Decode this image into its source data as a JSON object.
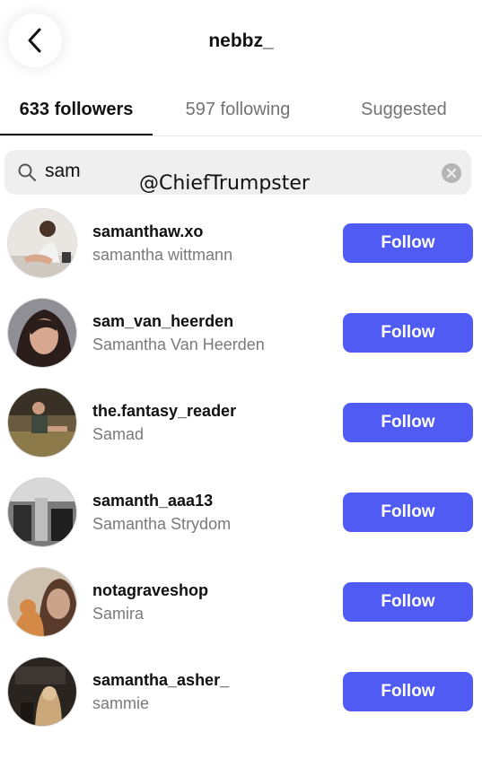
{
  "header": {
    "title": "nebbz_",
    "back_icon": "chevron-left-icon"
  },
  "tabs": [
    {
      "label": "633 followers",
      "active": true
    },
    {
      "label": "597 following",
      "active": false
    },
    {
      "label": "Suggested",
      "active": false
    }
  ],
  "search": {
    "value": "sam",
    "search_icon": "search-icon",
    "clear_icon": "clear-icon"
  },
  "watermark": "@ChiefTrumpster",
  "accent_color": "#4f5bf2",
  "follow_label": "Follow",
  "users": [
    {
      "username": "samanthaw.xo",
      "name": "samantha wittmann",
      "button": "Follow"
    },
    {
      "username": "sam_van_heerden",
      "name": "Samantha Van Heerden",
      "button": "Follow"
    },
    {
      "username": "the.fantasy_reader",
      "name": "Samad",
      "button": "Follow"
    },
    {
      "username": "samanth_aaa13",
      "name": "Samantha Strydom",
      "button": "Follow"
    },
    {
      "username": "notagraveshop",
      "name": "Samira",
      "button": "Follow"
    },
    {
      "username": "samantha_asher_",
      "name": "sammie",
      "button": "Follow"
    }
  ]
}
